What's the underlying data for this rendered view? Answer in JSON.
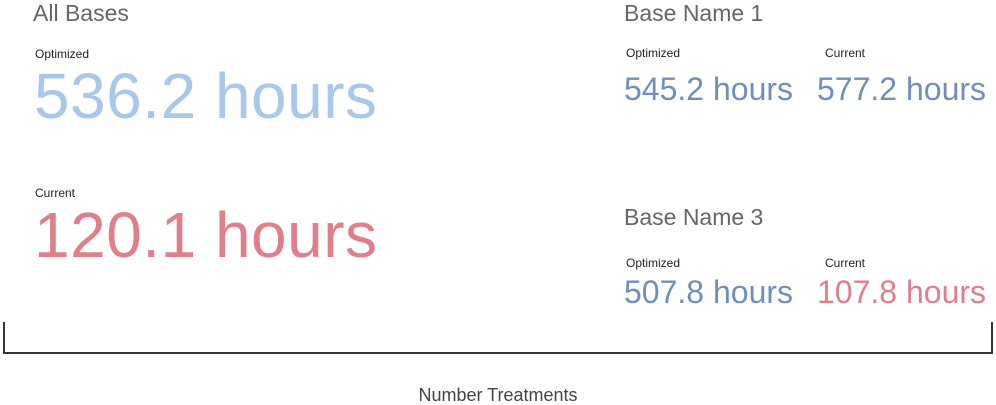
{
  "all_bases": {
    "title": "All Bases",
    "optimized_label": "Optimized",
    "optimized_value": "536.2 hours",
    "current_label": "Current",
    "current_value": "120.1 hours"
  },
  "base_1": {
    "title": "Base Name 1",
    "optimized_label": "Optimized",
    "optimized_value": "545.2 hours",
    "current_label": "Current",
    "current_value": "577.2 hours"
  },
  "base_3": {
    "title": "Base Name 3",
    "optimized_label": "Optimized",
    "optimized_value": "507.8 hours",
    "current_label": "Current",
    "current_value": "107.8 hours"
  },
  "footer": {
    "label": "Number Treatments"
  },
  "colors": {
    "optimized_light": "#a8c8ea",
    "optimized_dark": "#6f8fbb",
    "current": "#e07f8c",
    "title_gray": "#666666"
  }
}
